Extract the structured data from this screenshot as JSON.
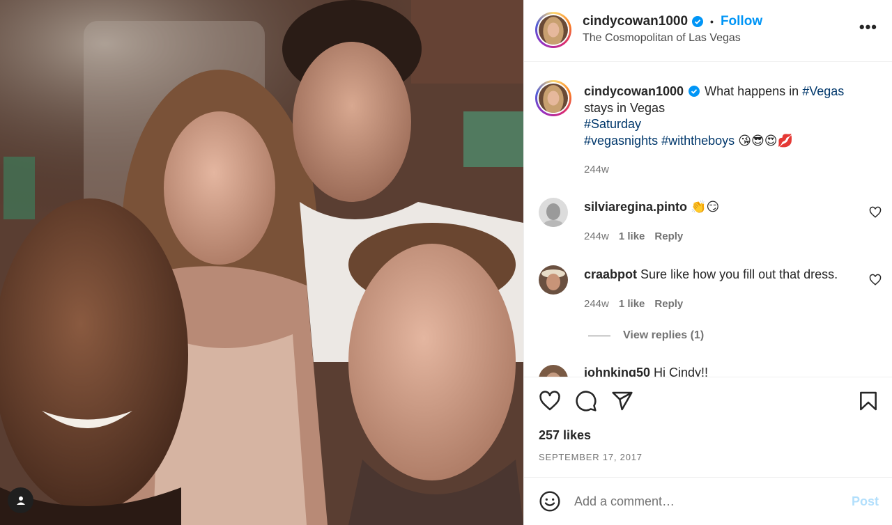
{
  "post": {
    "username": "cindycowan1000",
    "follow_label": "Follow",
    "dot": "•",
    "location": "The Cosmopolitan of Las Vegas",
    "more_label": "•••",
    "icons": {
      "verified": "verified-badge-icon",
      "more": "more-options-icon",
      "user_tag": "user-tag-icon"
    }
  },
  "caption": {
    "username": "cindycowan1000",
    "text_before": "What happens in ",
    "tag_vegas": "#Vegas",
    "text_after": " stays in Vegas",
    "tag_saturday": "#Saturday",
    "tag_vegasnights": "#vegasnights",
    "tag_withtheboys": "#withtheboys",
    "emojis": "😘😎😍💋",
    "time": "244w"
  },
  "comments": [
    {
      "username": "silviaregina.pinto",
      "text": "👏😏",
      "time": "244w",
      "likes": "1 like",
      "reply": "Reply"
    },
    {
      "username": "craabpot",
      "text": "Sure like how you fill out that dress.",
      "time": "244w",
      "likes": "1 like",
      "reply": "Reply"
    },
    {
      "username": "johnking50",
      "text": "Hi Cindy!!"
    }
  ],
  "view_replies": "View replies (1)",
  "actions": {
    "likes": "257 likes",
    "date": "SEPTEMBER 17, 2017",
    "icons": [
      "like-icon",
      "comment-icon",
      "share-icon",
      "save-icon"
    ]
  },
  "add_comment": {
    "placeholder": "Add a comment…",
    "post_label": "Post",
    "icon": "emoji-icon"
  },
  "colors": {
    "link": "#0095f6",
    "hashtag": "#00376b",
    "muted": "#737373",
    "post_disabled": "#b2dffc"
  }
}
